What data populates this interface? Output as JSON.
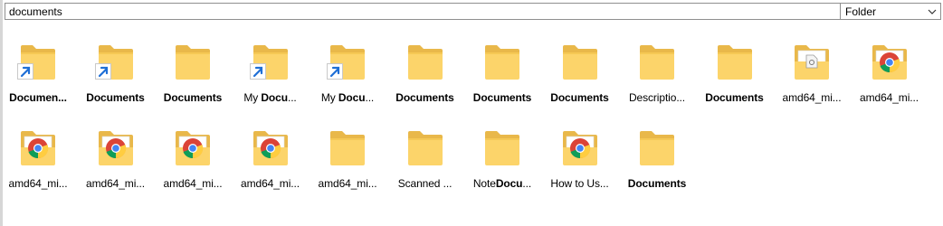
{
  "search": {
    "value": "documents"
  },
  "type_filter": {
    "selected": "Folder"
  },
  "items": [
    {
      "label": "Documen...",
      "bold": true,
      "overlay": "shortcut"
    },
    {
      "label": "Documents",
      "bold": true,
      "overlay": "shortcut"
    },
    {
      "label": "Documents",
      "bold": true,
      "overlay": "none"
    },
    {
      "label_parts": [
        "My ",
        "Docu",
        "..."
      ],
      "bold_part": 1,
      "overlay": "shortcut"
    },
    {
      "label_parts": [
        "My ",
        "Docu",
        "..."
      ],
      "bold_part": 1,
      "overlay": "shortcut"
    },
    {
      "label": "Documents",
      "bold": true,
      "overlay": "none"
    },
    {
      "label": "Documents",
      "bold": true,
      "overlay": "none"
    },
    {
      "label": "Documents",
      "bold": true,
      "overlay": "none"
    },
    {
      "label": "Descriptio...",
      "bold": false,
      "overlay": "none"
    },
    {
      "label": "Documents",
      "bold": true,
      "overlay": "none"
    },
    {
      "label": "amd64_mi...",
      "bold": false,
      "overlay": "file"
    },
    {
      "label": "amd64_mi...",
      "bold": false,
      "overlay": "chrome"
    },
    {
      "label": "amd64_mi...",
      "bold": false,
      "overlay": "chrome"
    },
    {
      "label": "amd64_mi...",
      "bold": false,
      "overlay": "chrome"
    },
    {
      "label": "amd64_mi...",
      "bold": false,
      "overlay": "chrome"
    },
    {
      "label": "amd64_mi...",
      "bold": false,
      "overlay": "chrome"
    },
    {
      "label": "amd64_mi...",
      "bold": false,
      "overlay": "none"
    },
    {
      "label": "Scanned ...",
      "bold": false,
      "overlay": "none"
    },
    {
      "label_parts": [
        "Note",
        "Docu",
        "..."
      ],
      "bold_part": 1,
      "overlay": "none"
    },
    {
      "label": "How to Us...",
      "bold": false,
      "overlay": "chrome"
    },
    {
      "label": "Documents",
      "bold": true,
      "overlay": "none"
    }
  ]
}
